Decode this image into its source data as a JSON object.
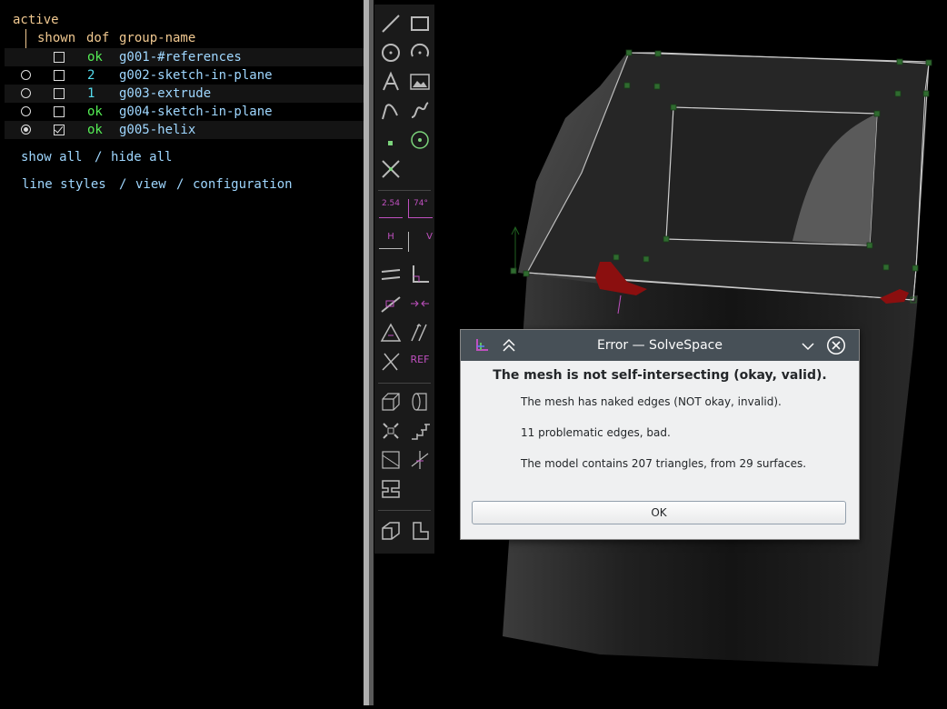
{
  "browser": {
    "header_active": "active",
    "header_shown": "shown",
    "header_dof": "dof",
    "header_group": "group-name",
    "groups": [
      {
        "dof": "ok",
        "name": "g001-#references",
        "active": false,
        "shown": false
      },
      {
        "dof": "2",
        "name": "g002-sketch-in-plane",
        "active": false,
        "shown": false
      },
      {
        "dof": "1",
        "name": "g003-extrude",
        "active": false,
        "shown": false
      },
      {
        "dof": "ok",
        "name": "g004-sketch-in-plane",
        "active": false,
        "shown": false
      },
      {
        "dof": "ok",
        "name": "g005-helix",
        "active": true,
        "shown": true
      }
    ],
    "show_all": "show all",
    "slash": "/",
    "hide_all": "hide all",
    "line_styles": "line styles",
    "view": "view",
    "configuration": "configuration"
  },
  "toolbar": {
    "dim_label": "2.54",
    "angle_label": "74°",
    "h_label": "H",
    "v_label": "V",
    "ref_label": "REF"
  },
  "dialog": {
    "title": "Error — SolveSpace",
    "heading": "The mesh is not self-intersecting (okay, valid).",
    "line1": "The mesh has naked edges (NOT okay, invalid).",
    "line2": "11 problematic edges, bad.",
    "line3": "The model contains 207 triangles, from 29 surfaces.",
    "ok_label": "OK"
  },
  "colors": {
    "ok_green": "#55ee55",
    "dof_cyan": "#55ddee",
    "group_blue": "#9fd7ff",
    "link_blue": "#9fd7ff",
    "header_orange": "#f0c890",
    "toolbar_icon": "#b9b9b9",
    "constraint_magenta": "#c050c0"
  }
}
